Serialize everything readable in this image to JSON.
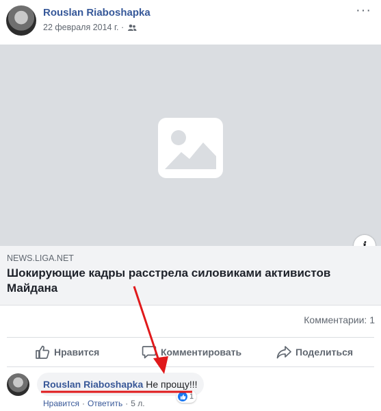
{
  "post": {
    "author": "Rouslan Riaboshapka",
    "date": "22 февраля 2014 г. ·",
    "audience_icon": "friends-icon",
    "more_icon": "more-dots-icon",
    "more_label": "···"
  },
  "image": {
    "placeholder_icon": "image-placeholder-icon",
    "info_label": "i"
  },
  "link": {
    "domain": "NEWS.LIGA.NET",
    "title": "Шокирующие кадры расстрела силовиками активистов Майдана"
  },
  "stats": {
    "comments": "Комментарии: 1"
  },
  "actions": {
    "like": "Нравится",
    "comment": "Комментировать",
    "share": "Поделиться"
  },
  "comment": {
    "author": "Rouslan Riaboshapka",
    "text": "Не прощу!!!",
    "reaction_count": "1",
    "like_label": "Нравится",
    "reply_label": "Ответить",
    "separator": "·",
    "age": "5 л."
  },
  "colors": {
    "link_blue": "#365899",
    "annotation_red": "#e0191b",
    "like_blue": "#1877f2"
  }
}
